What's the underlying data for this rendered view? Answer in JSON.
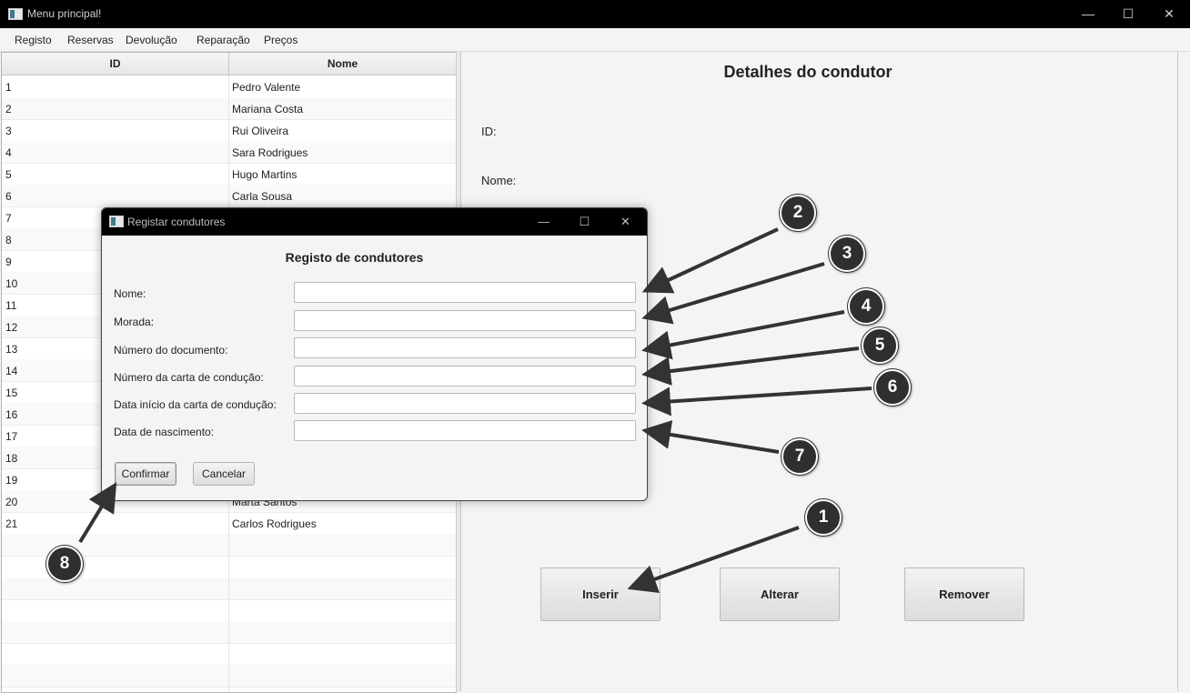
{
  "window": {
    "title": "Menu principal!",
    "minimize_icon": "minimize-icon",
    "maximize_icon": "maximize-icon",
    "close_icon": "close-icon"
  },
  "menubar": {
    "items": [
      "Registo",
      "Reservas",
      "Devolução",
      "Reparação",
      "Preços"
    ]
  },
  "table": {
    "columns": [
      "ID",
      "Nome"
    ],
    "rows": [
      [
        "1",
        "Pedro Valente"
      ],
      [
        "2",
        "Mariana Costa"
      ],
      [
        "3",
        "Rui Oliveira"
      ],
      [
        "4",
        "Sara Rodrigues"
      ],
      [
        "5",
        "Hugo Martins"
      ],
      [
        "6",
        "Carla Sousa"
      ],
      [
        "7",
        ""
      ],
      [
        "8",
        ""
      ],
      [
        "9",
        ""
      ],
      [
        "10",
        ""
      ],
      [
        "11",
        ""
      ],
      [
        "12",
        ""
      ],
      [
        "13",
        ""
      ],
      [
        "14",
        ""
      ],
      [
        "15",
        ""
      ],
      [
        "16",
        ""
      ],
      [
        "17",
        ""
      ],
      [
        "18",
        ""
      ],
      [
        "19",
        ""
      ],
      [
        "20",
        "Marta Santos"
      ],
      [
        "21",
        "Carlos Rodrigues"
      ]
    ]
  },
  "details": {
    "title": "Detalhes do condutor",
    "id_label": "ID:",
    "name_label": "Nome:",
    "buttons": {
      "insert": "Inserir",
      "edit": "Alterar",
      "remove": "Remover"
    }
  },
  "dialog": {
    "title": "Registar condutores",
    "heading": "Registo de condutores",
    "fields": [
      {
        "label": "Nome:",
        "value": ""
      },
      {
        "label": "Morada:",
        "value": ""
      },
      {
        "label": "Número do documento:",
        "value": ""
      },
      {
        "label": "Número da carta de condução:",
        "value": ""
      },
      {
        "label": "Data início da carta de condução:",
        "value": ""
      },
      {
        "label": "Data de nascimento:",
        "value": ""
      }
    ],
    "confirm": "Confirmar",
    "cancel": "Cancelar"
  },
  "callouts": [
    "1",
    "2",
    "3",
    "4",
    "5",
    "6",
    "7",
    "8"
  ],
  "colors": {
    "titlebar": "#000000",
    "callout": "#2f2f2f",
    "arrow": "#333333"
  }
}
